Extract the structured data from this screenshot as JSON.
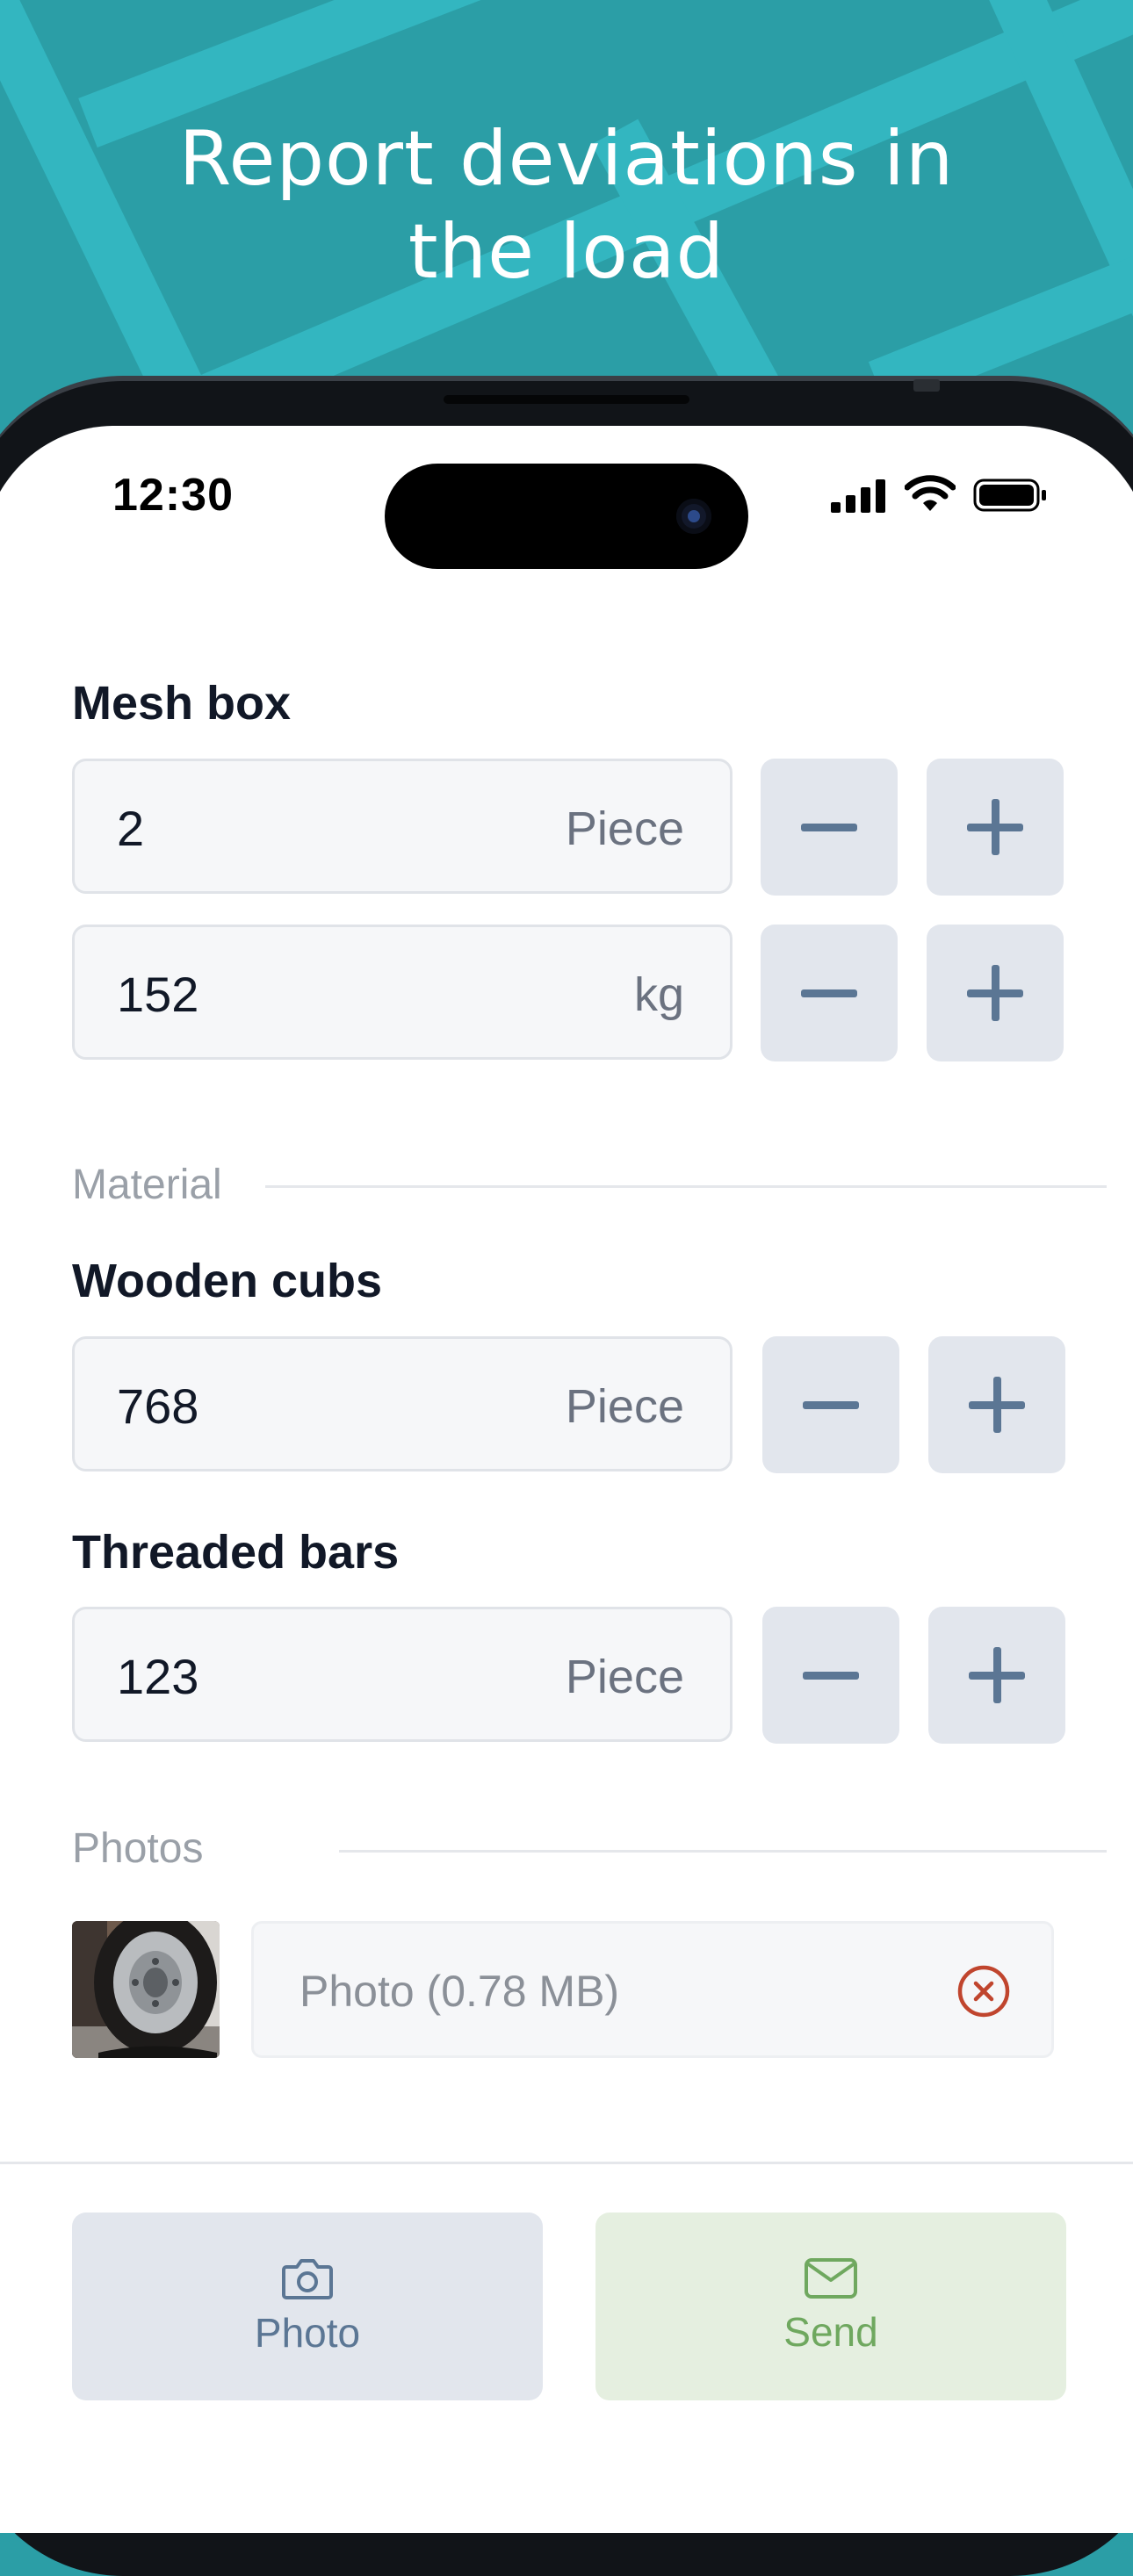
{
  "banner": {
    "headline_line1": "Report deviations in",
    "headline_line2": "the load"
  },
  "status_bar": {
    "time": "12:30",
    "icons": [
      "cellular-signal-icon",
      "wifi-icon",
      "battery-icon"
    ]
  },
  "mesh_box": {
    "title": "Mesh box",
    "pieces": {
      "value": "2",
      "unit": "Piece"
    },
    "weight": {
      "value": "152",
      "unit": "kg"
    }
  },
  "material": {
    "divider_label": "Material",
    "items": [
      {
        "title": "Wooden cubs",
        "value": "768",
        "unit": "Piece"
      },
      {
        "title": "Threaded bars",
        "value": "123",
        "unit": "Piece"
      }
    ]
  },
  "photos": {
    "divider_label": "Photos",
    "items": [
      {
        "label": "Photo (0.78 MB)"
      }
    ]
  },
  "actions": {
    "photo_label": "Photo",
    "send_label": "Send"
  },
  "colors": {
    "banner_bg": "#2b9ea6",
    "stepper_bg": "#e2e6ed",
    "stepper_icon": "#5b7694",
    "send_bg": "#e5efe0",
    "send_text": "#6fa85f",
    "remove_icon": "#c0452e"
  }
}
